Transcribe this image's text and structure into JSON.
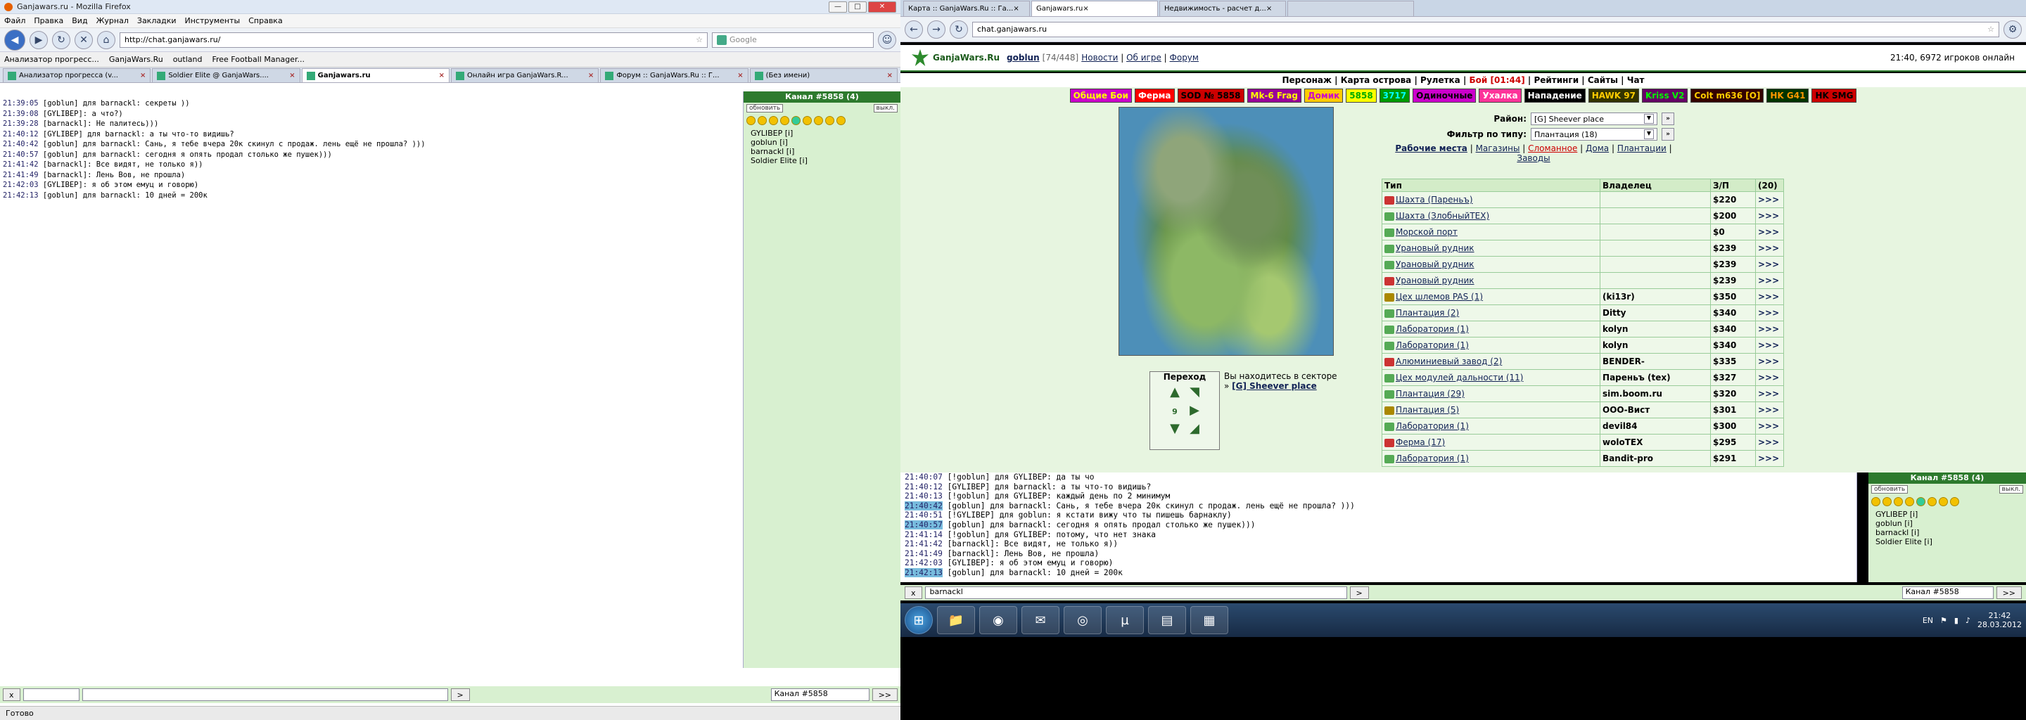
{
  "left": {
    "window_title": "Ganjawars.ru - Mozilla Firefox",
    "menu": [
      "Файл",
      "Правка",
      "Вид",
      "Журнал",
      "Закладки",
      "Инструменты",
      "Справка"
    ],
    "url": "http://chat.ganjawars.ru/",
    "search_placeholder": "Google",
    "bookmarks": [
      "Анализатор прогресс...",
      "GanjaWars.Ru",
      "outland",
      "Free Football Manager..."
    ],
    "tabs": [
      "Анализатор прогресса (v...",
      "Soldier Elite @ GanjaWars....",
      "Ganjawars.ru",
      "Онлайн игра GanjaWars.R...",
      "Форум :: GanjaWars.Ru :: Г...",
      "(Без имени)"
    ],
    "chat": [
      {
        "t": "21:39:05",
        "m": "[goblun] для barnackl: секреты ))"
      },
      {
        "t": "21:39:08",
        "m": "[GYLIBEP]: а что?)"
      },
      {
        "t": "21:39:28",
        "m": "[barnackl]: Не палитесь)))"
      },
      {
        "t": "21:40:12",
        "m": "[GYLIBEP] для barnackl: а ты что-то видишь?"
      },
      {
        "t": "21:40:42",
        "m": "[goblun] для barnackl: Сань, я тебе вчера 20к скинул с продаж. лень ещё не прошла? )))"
      },
      {
        "t": "21:40:57",
        "m": "[goblun] для barnackl: сегодня я опять продал столько же пушек)))"
      },
      {
        "t": "21:41:42",
        "m": "[barnackl]: Все видят, не только я))"
      },
      {
        "t": "21:41:49",
        "m": "[barnackl]: Лень Вов, не прошла)"
      },
      {
        "t": "21:42:03",
        "m": "[GYLIBEP]: я об этом емуц и говорю)"
      },
      {
        "t": "21:42:13",
        "m": "[goblun] для barnackl: 10 дней = 200к"
      }
    ],
    "channel": {
      "title": "Канал #5858 (4)",
      "refresh": "обновить",
      "off": "выкл.",
      "select": "Канал #5858"
    },
    "users": [
      "GYLIBEP [i]",
      "goblun [i]",
      "barnackl [i]",
      "Soldier Elite [i]"
    ],
    "status": "Готово",
    "send_btn": ">",
    "send2_btn": ">>",
    "clear_btn": "x"
  },
  "right": {
    "tabs": [
      "Карта :: GanjaWars.Ru :: Га...",
      "Ganjawars.ru",
      "Недвижимость - расчет д...",
      ""
    ],
    "url": "chat.ganjawars.ru",
    "logo": "GanjaWars.Ru",
    "user": "goblun",
    "level": "[74/448]",
    "toplinks": [
      "Новости",
      "Об игре",
      "Форум"
    ],
    "online": "21:40, 6972 игроков онлайн",
    "nav": [
      "Персонаж",
      "Карта острова",
      "Рулетка",
      "Бой [01:44]",
      "Рейтинги",
      "Сайты",
      "Чат"
    ],
    "banners": [
      {
        "t": "Общие Бои",
        "bg": "#cc00cc",
        "fg": "#ffff00"
      },
      {
        "t": "Ферма",
        "bg": "#ff0000",
        "fg": "#ffffff"
      },
      {
        "t": "SOD № 5858",
        "bg": "#cc0000",
        "fg": "#000000"
      },
      {
        "t": "Mk-6 Frag",
        "bg": "#990099",
        "fg": "#ffff00"
      },
      {
        "t": "Домик",
        "bg": "#ffcc00",
        "fg": "#cc00cc"
      },
      {
        "t": "5858",
        "bg": "#ffff00",
        "fg": "#00aa00"
      },
      {
        "t": "3717",
        "bg": "#009900",
        "fg": "#00ffff"
      },
      {
        "t": "Одиночные",
        "bg": "#cc00cc",
        "fg": "#000000"
      },
      {
        "t": "Ухалка",
        "bg": "#ff3399",
        "fg": "#ffffff"
      },
      {
        "t": "Нападение",
        "bg": "#000000",
        "fg": "#ffffff"
      },
      {
        "t": "HAWK 97",
        "bg": "#333300",
        "fg": "#ffcc00"
      },
      {
        "t": "Kriss V2",
        "bg": "#660066",
        "fg": "#00ff00"
      },
      {
        "t": "Colt m636 [O]",
        "bg": "#330000",
        "fg": "#ffcc00"
      },
      {
        "t": "HK G41",
        "bg": "#003300",
        "fg": "#ff9900"
      },
      {
        "t": "HK SMG",
        "bg": "#cc0000",
        "fg": "#000000"
      }
    ],
    "district_label": "Район:",
    "district_value": "[G] Sheever place",
    "filter_label": "Фильтр по типу:",
    "filter_value": "Плантация (18)",
    "links": [
      "Рабочие места",
      "Магазины",
      "Сломанное",
      "Дома",
      "Плантации",
      "Заводы"
    ],
    "table_headers": [
      "Тип",
      "Владелец",
      "З/П",
      "(20)"
    ],
    "rows": [
      {
        "type": "Шахта (Пареньъ)",
        "owner": "",
        "pay": "$220",
        "go": ">>>"
      },
      {
        "type": "Шахта (ЗлобныйTEX)",
        "owner": "",
        "pay": "$200",
        "go": ">>>"
      },
      {
        "type": "Морской порт",
        "owner": "",
        "pay": "$0",
        "go": ">>>"
      },
      {
        "type": "Урановый рудник",
        "owner": "",
        "pay": "$239",
        "go": ">>>"
      },
      {
        "type": "Урановый рудник",
        "owner": "",
        "pay": "$239",
        "go": ">>>"
      },
      {
        "type": "Урановый рудник",
        "owner": "",
        "pay": "$239",
        "go": ">>>"
      },
      {
        "type": "Цех шлемов PAS (1)",
        "owner": "(ki13r)",
        "pay": "$350",
        "go": ">>>"
      },
      {
        "type": "Плантация (2)",
        "owner": "Ditty",
        "pay": "$340",
        "go": ">>>"
      },
      {
        "type": "Лаборатория (1)",
        "owner": "kolyn",
        "pay": "$340",
        "go": ">>>"
      },
      {
        "type": "Лаборатория (1)",
        "owner": "kolyn",
        "pay": "$340",
        "go": ">>>"
      },
      {
        "type": "Алюминиевый завод (2)",
        "owner": "BENDER-",
        "pay": "$335",
        "go": ">>>"
      },
      {
        "type": "Цех модулей дальности (11)",
        "owner": "Пареньъ (tex)",
        "pay": "$327",
        "go": ">>>"
      },
      {
        "type": "Плантация (29)",
        "owner": "sim.boom.ru",
        "pay": "$320",
        "go": ">>>"
      },
      {
        "type": "Плантация (5)",
        "owner": "ООО-Вист",
        "pay": "$301",
        "go": ">>>"
      },
      {
        "type": "Лаборатория (1)",
        "owner": "devil84",
        "pay": "$300",
        "go": ">>>"
      },
      {
        "type": "Ферма (17)",
        "owner": "woloTEX",
        "pay": "$295",
        "go": ">>>"
      },
      {
        "type": "Лаборатория (1)",
        "owner": "Bandit-pro",
        "pay": "$291",
        "go": ">>>"
      }
    ],
    "perehod": "Переход",
    "perehod_num": "9",
    "youare": "Вы находитесь в секторе",
    "sector": "[G] Sheever place",
    "chat": [
      {
        "t": "21:40:07",
        "m": "[!goblun] для GYLIBEP: да ты чо",
        "hl": false
      },
      {
        "t": "21:40:12",
        "m": "[GYLIBEP] для barnackl: а ты что-то видишь?",
        "hl": false
      },
      {
        "t": "21:40:13",
        "m": "[!goblun] для GYLIBEP: каждый день по 2 минимум",
        "hl": false
      },
      {
        "t": "21:40:42",
        "m": "[goblun] для barnackl: Сань, я тебе вчера 20к скинул с продаж. лень ещё не прошла? )))",
        "hl": true
      },
      {
        "t": "21:40:51",
        "m": "[!GYLIBEP] для goblun: я кстати вижу что ты пишешь барнаклу)",
        "hl": false
      },
      {
        "t": "21:40:57",
        "m": "[goblun] для barnackl: сегодня я опять продал столько же пушек)))",
        "hl": true
      },
      {
        "t": "21:41:14",
        "m": "[!goblun] для GYLIBEP: потому, что нет знака",
        "hl": false
      },
      {
        "t": "21:41:42",
        "m": "[barnackl]: Все видят, не только я))",
        "hl": false
      },
      {
        "t": "21:41:49",
        "m": "[barnackl]: Лень Вов, не прошла)",
        "hl": false
      },
      {
        "t": "21:42:03",
        "m": "[GYLIBEP]: я об этом емуц и говорю)",
        "hl": false
      },
      {
        "t": "21:42:13",
        "m": "[goblun] для barnackl: 10 дней = 200к",
        "hl": true
      }
    ],
    "chat_input": "barnackl",
    "channel_title": "Канал #5858 (4)",
    "channel_select": "Канал #5858",
    "users": [
      "GYLIBEP [i]",
      "goblun [i]",
      "barnackl [i]",
      "Soldier Elite [i]"
    ],
    "lang": "EN",
    "time": "21:42",
    "date": "28.03.2012"
  }
}
